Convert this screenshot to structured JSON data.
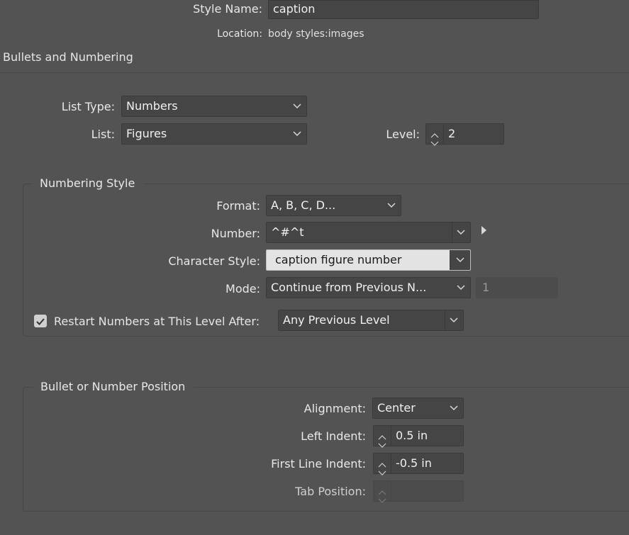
{
  "header": {
    "style_name_label": "Style Name:",
    "style_name_value": "caption",
    "location_label": "Location:",
    "location_value": "body styles:images"
  },
  "section_title": "Bullets and Numbering",
  "list_type": {
    "label": "List Type:",
    "value": "Numbers"
  },
  "list": {
    "label": "List:",
    "value": "Figures"
  },
  "level": {
    "label": "Level:",
    "value": "2"
  },
  "numbering_style": {
    "title": "Numbering Style",
    "format": {
      "label": "Format:",
      "value": "A, B, C, D..."
    },
    "number": {
      "label": "Number:",
      "value": "^#^t"
    },
    "character_style": {
      "label": "Character Style:",
      "value": "caption figure number"
    },
    "mode": {
      "label": "Mode:",
      "value": "Continue from Previous N...",
      "start_value": "1"
    },
    "restart": {
      "label": "Restart Numbers at This Level After:",
      "checked": true,
      "value": "Any Previous Level"
    }
  },
  "position": {
    "title": "Bullet or Number Position",
    "alignment": {
      "label": "Alignment:",
      "value": "Center"
    },
    "left_indent": {
      "label": "Left Indent:",
      "value": "0.5 in"
    },
    "first_line_indent": {
      "label": "First Line Indent:",
      "value": "-0.5 in"
    },
    "tab_position": {
      "label": "Tab Position:",
      "value": ""
    }
  },
  "icons": {
    "dropdown": "chevron-down-icon",
    "stepper_up": "chevron-up-icon",
    "stepper_down": "chevron-down-icon",
    "flyout": "triangle-right-icon",
    "checkbox": "checkmark-icon"
  },
  "colors": {
    "background": "#535353",
    "field": "#454545",
    "field_light": "#e3e3e3",
    "text": "#e8e8e8"
  }
}
